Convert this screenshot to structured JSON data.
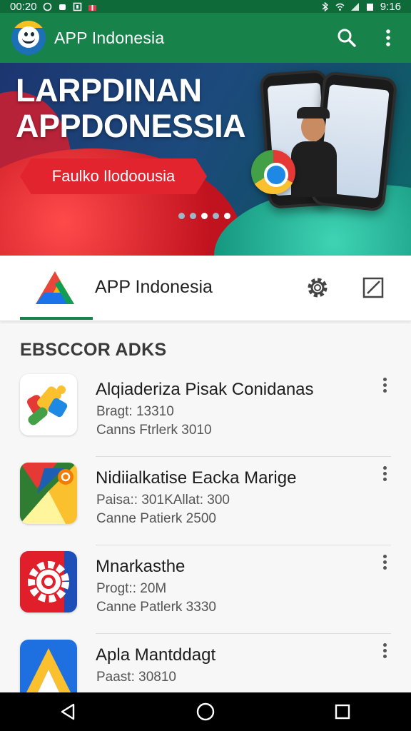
{
  "status_bar": {
    "time": "00:20",
    "right_time": "9:16",
    "left_icons": [
      "whatsapp-icon",
      "android-icon",
      "notification-icon",
      "gift-icon"
    ],
    "right_icons": [
      "bluetooth-icon",
      "wifi-icon",
      "signal-icon",
      "battery-icon"
    ]
  },
  "app_bar": {
    "title": "APP Indonesia",
    "actions": [
      "search-icon",
      "more-vert-icon"
    ]
  },
  "banner": {
    "headline_line1": "LARPDINAN",
    "headline_line2": "APPDONESSIA",
    "cta_label": "Faulko Ilodoousia",
    "carousel_dots": 5,
    "active_dots": [
      2,
      4
    ]
  },
  "tab_header": {
    "title": "APP Indonesia",
    "actions": [
      "gear-icon",
      "edit-icon"
    ]
  },
  "section": {
    "title": "EBSCCOR ADKS"
  },
  "apps": [
    {
      "name": "Alqiaderiza Pisak  Conidanas",
      "meta1": "Bragt: 13310",
      "meta2": "Canns Ftrlerk 3010",
      "icon": "blocks-icon"
    },
    {
      "name": "Nidiialkatise Eacka Marige",
      "meta1": "Paisa:: 301KAllat: 300",
      "meta2": "Canne Patierk 2500",
      "icon": "paper-plane-icon"
    },
    {
      "name": "Mnarkasthe",
      "meta1": "Progt:: 20M",
      "meta2": "Canne Patlerk 3330",
      "icon": "gear-app-icon"
    },
    {
      "name": "Apla Mantddagt",
      "meta1": "Paast: 30810",
      "meta2": "",
      "icon": "triangle-a-icon"
    }
  ],
  "nav_bar": {
    "buttons": [
      "back-icon",
      "home-icon",
      "recents-icon"
    ]
  },
  "colors": {
    "status_bar": "#0f6a3a",
    "app_bar": "#17834a",
    "accent_underline": "#17834a",
    "cta_red": "#e2242e",
    "nav_bar": "#000000"
  }
}
